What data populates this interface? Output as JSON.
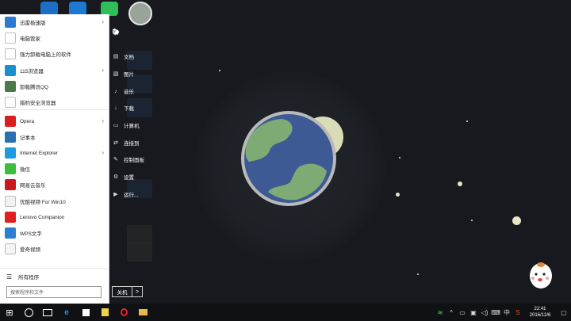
{
  "start_menu": {
    "apps": [
      {
        "label": "迅雷极速版",
        "icon": "thunder-icon",
        "color": "#2b79d0",
        "chev": true
      },
      {
        "label": "电脑管家",
        "icon": "doc-icon",
        "color": "#ffffff",
        "chev": false
      },
      {
        "label": "强力卸载电脑上的软件",
        "icon": "doc-icon",
        "color": "#ffffff",
        "chev": false
      },
      {
        "label": "115浏览器",
        "icon": "browser-115-icon",
        "color": "#1a8fd0",
        "chev": true
      },
      {
        "label": "卸载腾讯QQ",
        "icon": "qq-uninstall-icon",
        "color": "#4a7a4a",
        "chev": false
      },
      {
        "label": "猎豹安全浏览器",
        "icon": "doc-icon",
        "color": "#ffffff",
        "chev": false
      },
      {
        "label": "Opera",
        "icon": "opera-icon",
        "color": "#d81e1e",
        "chev": true
      },
      {
        "label": "记事本",
        "icon": "notepad-icon",
        "color": "#2a6fb0",
        "chev": false
      },
      {
        "label": "Internet Explorer",
        "icon": "ie-icon",
        "color": "#1e9be0",
        "chev": true
      },
      {
        "label": "微信",
        "icon": "wechat-icon",
        "color": "#3dbd3d",
        "chev": false
      },
      {
        "label": "网易云音乐",
        "icon": "netease-music-icon",
        "color": "#c9181e",
        "chev": false
      },
      {
        "label": "优酷视频 For Win10",
        "icon": "youku-icon",
        "color": "#f2f2f2",
        "chev": false
      },
      {
        "label": "Lenovo Companion",
        "icon": "lenovo-icon",
        "color": "#e02020",
        "chev": false
      },
      {
        "label": "WPS文字",
        "icon": "wps-icon",
        "color": "#2a7fd0",
        "chev": false
      },
      {
        "label": "爱奇视频",
        "icon": "video-icon",
        "color": "#f5f5f5",
        "chev": false
      }
    ],
    "all_programs": "所有程序",
    "search_placeholder": "搜索程序和文件",
    "right_column": [
      {
        "label": "文档",
        "icon": "documents-icon"
      },
      {
        "label": "图片",
        "icon": "pictures-icon"
      },
      {
        "label": "音乐",
        "icon": "music-icon"
      },
      {
        "label": "下载",
        "icon": "download-icon"
      },
      {
        "label": "计算机",
        "icon": "computer-icon"
      },
      {
        "label": "连接到",
        "icon": "connect-icon"
      },
      {
        "label": "控制面板",
        "icon": "control-panel-icon"
      },
      {
        "label": "设置",
        "icon": "settings-icon"
      },
      {
        "label": "运行...",
        "icon": "run-icon"
      }
    ],
    "shutdown_label": "关机",
    "shutdown_arrow": ">"
  },
  "taskbar": {
    "clock_time": "22:41",
    "clock_date": "2016/12/6",
    "ime_label": "中"
  }
}
